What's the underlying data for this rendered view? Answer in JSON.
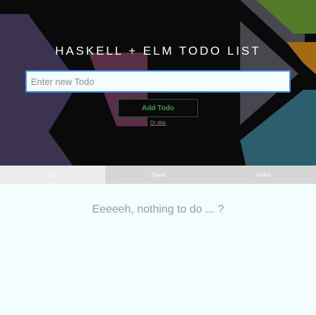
{
  "header": {
    "title": "HASKELL + ELM TODO LIST",
    "input_placeholder": "Enter new Todo",
    "add_button_label": "Add Todo",
    "skip_link_label": "Or skip"
  },
  "tabs": [
    {
      "label": "All",
      "active": true
    },
    {
      "label": "Done",
      "active": false
    },
    {
      "label": "Active",
      "active": false
    }
  ],
  "main": {
    "empty_message": "Eeeeeh, nothing to do ... ?"
  },
  "colors": {
    "input_border": "#3b87d9",
    "add_button_text": "#2ea04d",
    "page_background": "#f4fdfd"
  }
}
